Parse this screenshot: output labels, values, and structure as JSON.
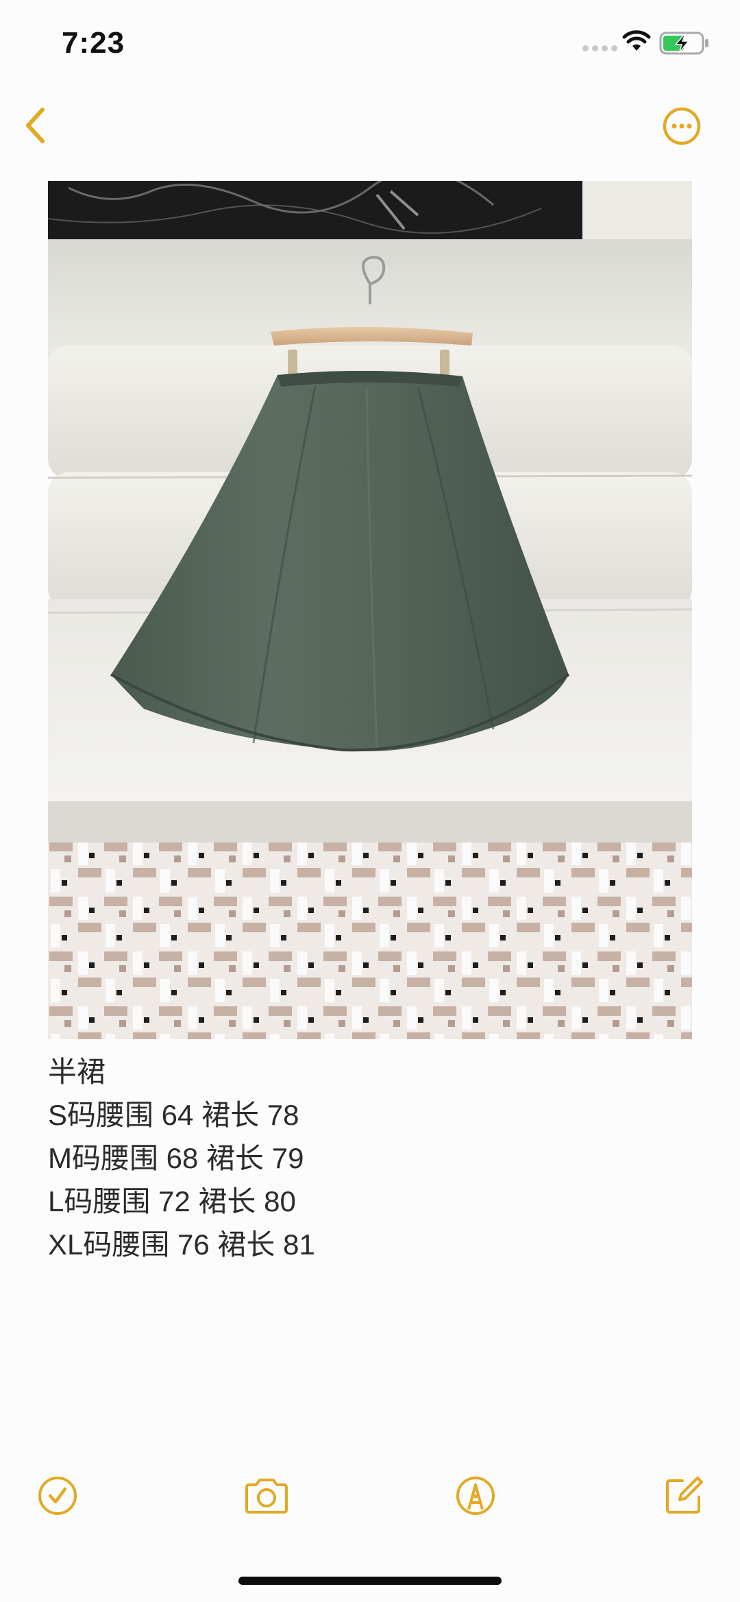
{
  "status_bar": {
    "time": "7:23",
    "wifi_icon": "wifi-icon",
    "battery_icon": "battery-charging-icon"
  },
  "nav": {
    "back_icon": "chevron-left-icon",
    "more_icon": "ellipsis-circle-icon"
  },
  "note": {
    "title": "半裙",
    "lines": [
      "S码腰围 64 裙长 78",
      "M码腰围 68 裙长 79",
      "L码腰围 72 裙长 80",
      "XL码腰围 76 裙长 81"
    ]
  },
  "toolbar": {
    "checklist_icon": "checkmark-circle-icon",
    "camera_icon": "camera-icon",
    "markup_icon": "pen-tip-circle-icon",
    "compose_icon": "compose-icon"
  },
  "colors": {
    "accent": "#e1a924",
    "text": "#2b2b2b",
    "background": "#fdfcfd"
  }
}
